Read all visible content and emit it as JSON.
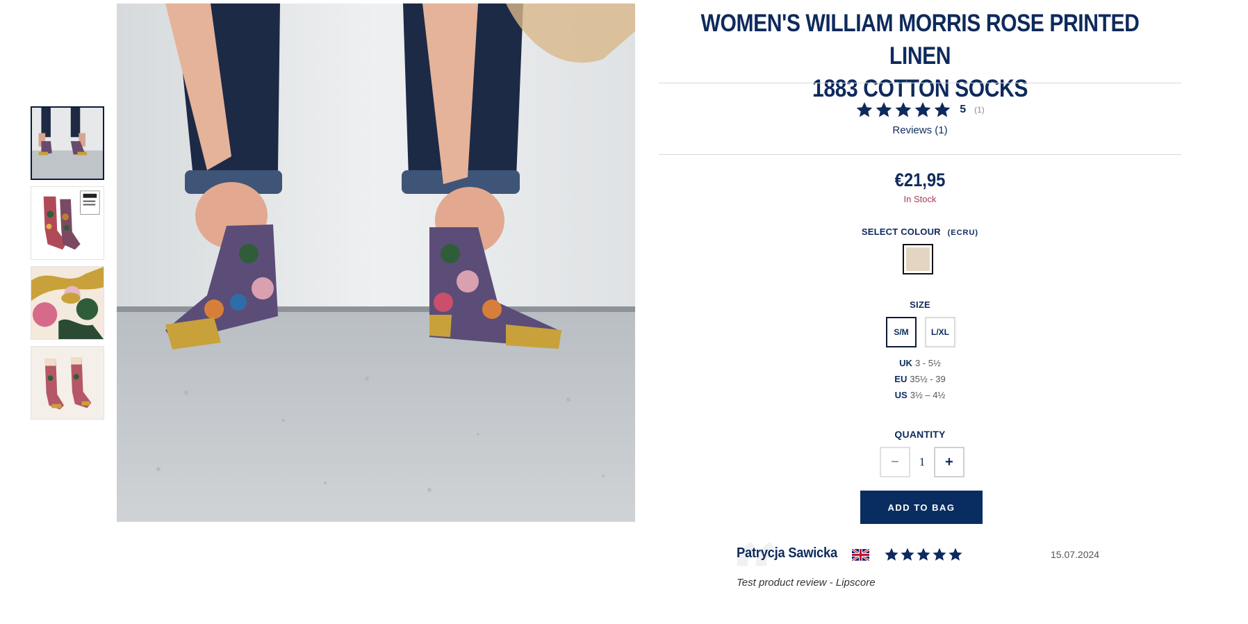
{
  "product": {
    "title_line1": "WOMEN'S WILLIAM MORRIS ROSE PRINTED LINEN",
    "title_line2": "1883 COTTON SOCKS",
    "rating_value": "5",
    "rating_count": "(1)",
    "rating_stars": 5,
    "reviews_link": "Reviews (1)",
    "price": "€21,95",
    "stock_status": "In Stock"
  },
  "colour": {
    "label": "SELECT COLOUR",
    "selected": "(ECRU)",
    "swatch_color": "#e3d5c1"
  },
  "size": {
    "label": "SIZE",
    "options": [
      "S/M",
      "L/XL"
    ],
    "selected": "S/M",
    "conversions": [
      {
        "region": "UK",
        "range": "3 - 5½"
      },
      {
        "region": "EU",
        "range": "35½ - 39"
      },
      {
        "region": "US",
        "range": "3½ – 4½"
      }
    ]
  },
  "quantity": {
    "label": "QUANTITY",
    "minus": "−",
    "value": "1",
    "plus": "+"
  },
  "cart": {
    "add_label": "ADD TO BAG"
  },
  "review": {
    "author": "Patrycja Sawicka",
    "stars": 5,
    "date": "15.07.2024",
    "text": "Test product review - Lipscore"
  },
  "colors": {
    "brand_navy": "#0e2a5c",
    "button_navy": "#0a2d61",
    "stock_red": "#a43c52"
  },
  "icons": [
    "star-icon",
    "uk-flag-icon",
    "quote-icon"
  ]
}
